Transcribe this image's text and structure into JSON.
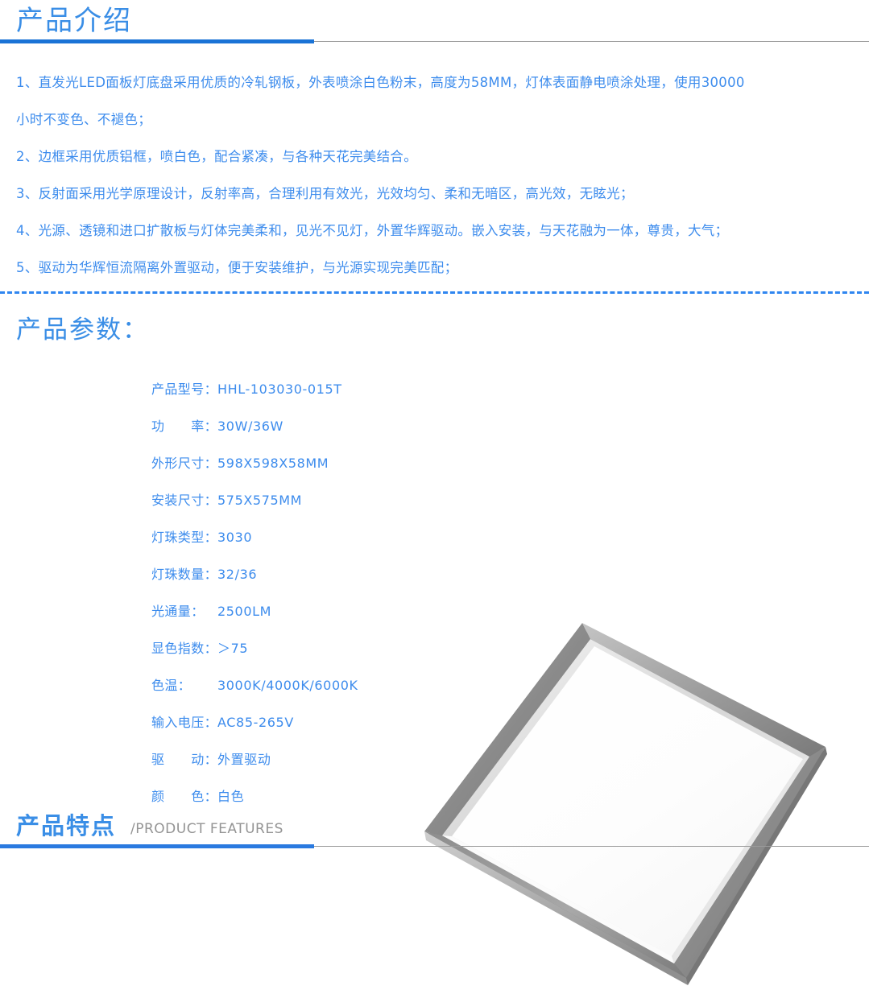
{
  "intro": {
    "heading": "产品介绍",
    "items": [
      "1、直发光LED面板灯底盘采用优质的冷轧钢板，外表喷涂白色粉末，高度为58MM，灯体表面静电喷涂处理，使用30000",
      "小时不变色、不褪色；",
      "2、边框采用优质铝框，喷白色，配合紧凑，与各种天花完美结合。",
      "3、反射面采用光学原理设计，反射率高，合理利用有效光，光效均匀、柔和无暗区，高光效，无眩光；",
      "4、光源、透镜和进口扩散板与灯体完美柔和，见光不见灯，外置华辉驱动。嵌入安装，与天花融为一体，尊贵，大气；",
      "5、驱动为华辉恒流隔离外置驱动，便于安装维护，与光源实现完美匹配；"
    ]
  },
  "params": {
    "heading": "产品参数：",
    "rows": [
      {
        "label": "产品型号：",
        "value": "HHL-103030-015T"
      },
      {
        "label": "功　　率：",
        "value": "30W/36W"
      },
      {
        "label": "外形尺寸：",
        "value": "598X598X58MM"
      },
      {
        "label": "安装尺寸：",
        "value": "575X575MM"
      },
      {
        "label": "灯珠类型：",
        "value": "3030"
      },
      {
        "label": "灯珠数量：",
        "value": "32/36"
      },
      {
        "label": "光通量：",
        "value": "2500LM"
      },
      {
        "label": "显色指数：",
        "value": "＞75"
      },
      {
        "label": "色温：",
        "value": "3000K/4000K/6000K"
      },
      {
        "label": "输入电压：",
        "value": "AC85-265V"
      },
      {
        "label": "驱　　动：",
        "value": "外置驱动"
      },
      {
        "label": "颜　　色：",
        "value": "白色"
      }
    ]
  },
  "product_image": {
    "alt": "LED面板灯产品图",
    "frame_color": "#9a9a9a",
    "panel_color": "#ffffff"
  },
  "features": {
    "heading_cn": "产品特点",
    "heading_en": "/PRODUCT FEATURES"
  },
  "colors": {
    "accent_blue": "#3a8ee6",
    "body_blue": "#3d8ced",
    "rule_blue": "#1a73d6",
    "rule_gray": "#9b9b9b",
    "en_gray": "#949494"
  }
}
